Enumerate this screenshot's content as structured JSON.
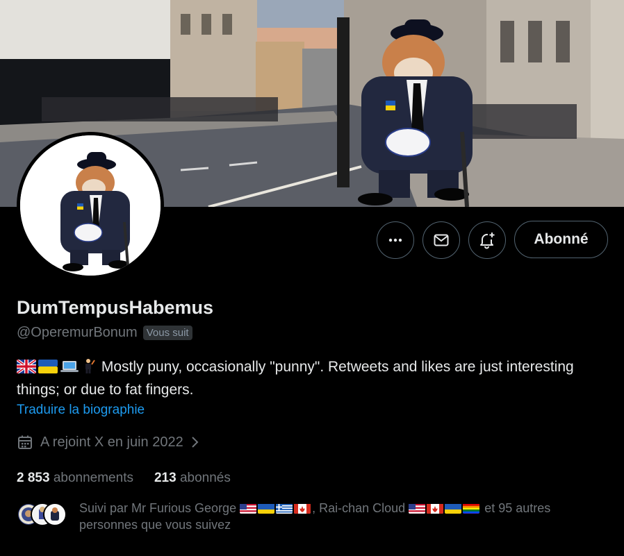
{
  "profile": {
    "display_name": "DumTempusHabemus",
    "handle": "@OperemurBonum",
    "follows_you_badge": "Vous suit",
    "bio_text": "Mostly puny, occasionally \"punny\". Retweets and likes are just interesting things; or due to fat fingers.",
    "translate_link": "Traduire la biographie",
    "joined": "A rejoint X en juin 2022"
  },
  "actions": {
    "more_icon": "more-icon",
    "message_icon": "mail-icon",
    "notify_icon": "bell-plus-icon",
    "follow_label": "Abonné"
  },
  "stats": {
    "following_count": "2 853",
    "following_label": "abonnements",
    "followers_count": "213",
    "followers_label": "abonnés"
  },
  "followed_by": {
    "prefix": "Suivi par Mr Furious George",
    "middle": ", Rai-chan Cloud",
    "suffix": "et 95 autres personnes que vous suivez"
  },
  "colors": {
    "background": "#000000",
    "link": "#1d9bf0",
    "muted": "#71767b",
    "text": "#e7e9ea",
    "border": "#536471"
  }
}
